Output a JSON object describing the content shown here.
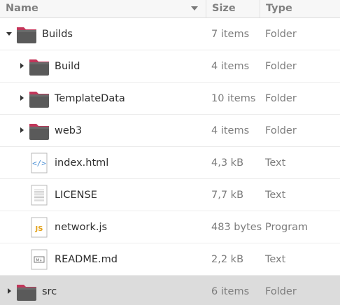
{
  "columns": {
    "name": "Name",
    "size": "Size",
    "type": "Type"
  },
  "sort": {
    "column": "name",
    "direction": "descending-arrow"
  },
  "rows": [
    {
      "name": "Builds",
      "size": "7 items",
      "type": "Folder",
      "kind": "folder",
      "depth": 0,
      "expander": "expanded",
      "icon": "folder-icon"
    },
    {
      "name": "Build",
      "size": "4 items",
      "type": "Folder",
      "kind": "folder",
      "depth": 1,
      "expander": "collapsed",
      "icon": "folder-icon"
    },
    {
      "name": "TemplateData",
      "size": "10 items",
      "type": "Folder",
      "kind": "folder",
      "depth": 1,
      "expander": "collapsed",
      "icon": "folder-icon"
    },
    {
      "name": "web3",
      "size": "4 items",
      "type": "Folder",
      "kind": "folder",
      "depth": 1,
      "expander": "collapsed",
      "icon": "folder-icon"
    },
    {
      "name": "index.html",
      "size": "4,3 kB",
      "type": "Text",
      "kind": "html",
      "depth": 1,
      "expander": "none",
      "icon": "html-file-icon"
    },
    {
      "name": "LICENSE",
      "size": "7,7 kB",
      "type": "Text",
      "kind": "text",
      "depth": 1,
      "expander": "none",
      "icon": "text-file-icon"
    },
    {
      "name": "network.js",
      "size": "483 bytes",
      "type": "Program",
      "kind": "js",
      "depth": 1,
      "expander": "none",
      "icon": "javascript-file-icon"
    },
    {
      "name": "README.md",
      "size": "2,2 kB",
      "type": "Text",
      "kind": "markdown",
      "depth": 1,
      "expander": "none",
      "icon": "markdown-file-icon"
    },
    {
      "name": "src",
      "size": "6 items",
      "type": "Folder",
      "kind": "folder",
      "depth": 0,
      "expander": "collapsed",
      "icon": "folder-icon",
      "selected": true
    }
  ],
  "colors": {
    "folder_body": "#5a5a5a",
    "folder_tab": "#c2365a",
    "selected_row": "#dcdcdc",
    "secondary_text": "#7c7c7c"
  }
}
